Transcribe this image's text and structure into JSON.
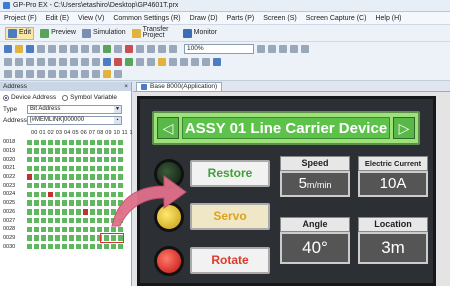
{
  "window": {
    "title": "GP-Pro EX - C:\\Users\\etashiro\\Desktop\\GP4601T.prx"
  },
  "menu": [
    "Project (F)",
    "Edit (E)",
    "View (V)",
    "Common Settings (R)",
    "Draw (D)",
    "Parts (P)",
    "Screen (S)",
    "Screen Capture (C)",
    "Help (H)"
  ],
  "toolbar": {
    "edit": "Edit",
    "preview": "Preview",
    "simulation": "Simulation",
    "transfer": "Transfer Project",
    "monitor": "Monitor",
    "zoom": "100%"
  },
  "address_panel": {
    "title": "Address",
    "radio_device": "Device Address",
    "radio_symbol": "Symbol Variable",
    "type_label": "Type",
    "type_value": "Bit Address",
    "address_label": "Address",
    "address_value": "[#MEMLINK]000000",
    "column_header": "00 01 02 03 04 05 06 07 08 09 10 11 12 13",
    "rows": [
      {
        "addr": "0018",
        "red": []
      },
      {
        "addr": "0019",
        "red": []
      },
      {
        "addr": "0020",
        "red": []
      },
      {
        "addr": "0021",
        "red": []
      },
      {
        "addr": "0022",
        "red": [
          0
        ]
      },
      {
        "addr": "0023",
        "red": []
      },
      {
        "addr": "0024",
        "red": [
          3
        ]
      },
      {
        "addr": "0025",
        "red": []
      },
      {
        "addr": "0026",
        "red": [
          8
        ]
      },
      {
        "addr": "0027",
        "red": []
      },
      {
        "addr": "0028",
        "red": []
      },
      {
        "addr": "0029",
        "red": []
      },
      {
        "addr": "0030",
        "red": []
      }
    ]
  },
  "screen_tab": "Base 8000(Application)",
  "hmi": {
    "title": "ASSY 01 Line Carrier Device",
    "restore": "Restore",
    "servo": "Servo",
    "rotate": "Rotate",
    "speed_label": "Speed",
    "speed_value": "5",
    "speed_unit": "m/min",
    "current_label": "Electric Current",
    "current_value": "10A",
    "angle_label": "Angle",
    "angle_value": "40°",
    "location_label": "Location",
    "location_value": "3m"
  },
  "colors": {
    "accent_green": "#5dc24a",
    "arrow": "#e0708a",
    "bit_on": "#5fb85f",
    "bit_red": "#c03232"
  }
}
